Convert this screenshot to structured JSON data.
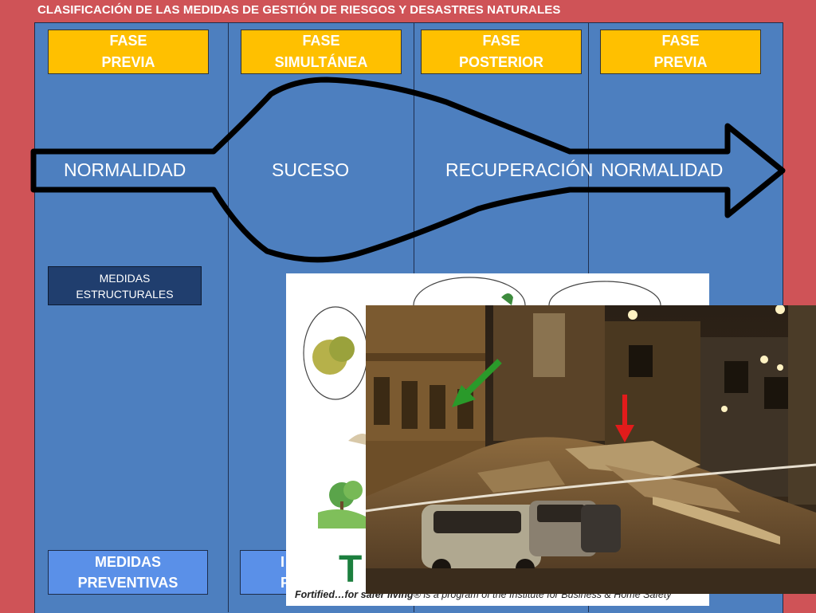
{
  "title": "CLASIFICACIÓN DE LAS MEDIDAS DE GESTIÓN DE RIESGOS Y DESASTRES NATURALES",
  "phases": [
    {
      "line1": "FASE",
      "line2": "PREVIA"
    },
    {
      "line1": "FASE",
      "line2": "SIMULTÁNEA"
    },
    {
      "line1": "FASE",
      "line2": "POSTERIOR"
    },
    {
      "line1": "FASE",
      "line2": "PREVIA"
    }
  ],
  "flow": [
    "NORMALIDAD",
    "SUCESO",
    "RECUPERACIÓN",
    "NORMALIDAD"
  ],
  "structural": {
    "line1": "MEDIDAS",
    "line2": "ESTRUCTURALES"
  },
  "preventive": {
    "line1": "MEDIDAS",
    "line2": "PREVENTIVAS"
  },
  "partial_box": {
    "line1": "I",
    "line2": "P"
  },
  "photo_caption": {
    "bold": "Fortified…for safer living",
    "rest": "® is a program of the Institute for Business & Home Safety"
  },
  "logo_text": "TI",
  "colors": {
    "background": "#cf5357",
    "panel": "#4d7fbf",
    "phase": "#ffc000",
    "dark_box": "#203e6e",
    "light_box": "#5a90e8",
    "arrow_green": "#2a9a2a",
    "arrow_red": "#e21b1b"
  }
}
